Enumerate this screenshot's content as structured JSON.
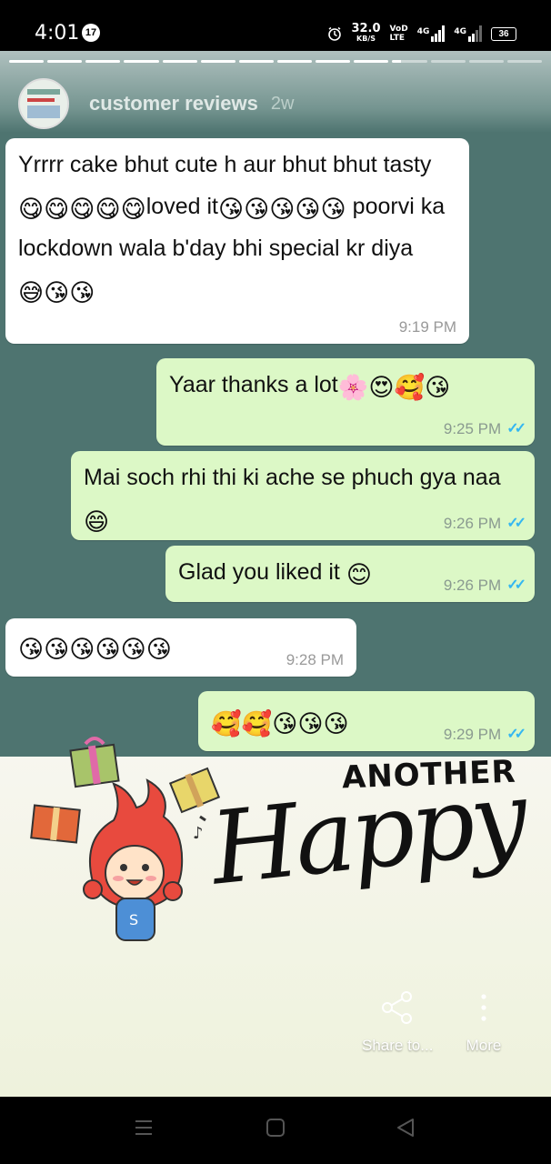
{
  "status_bar": {
    "time": "4:01",
    "notification_count": "17",
    "net_speed_value": "32.0",
    "net_speed_unit": "KB/S",
    "volte_top": "VoD",
    "volte_bottom": "LTE",
    "sim1_label": "4G",
    "sim2_label": "4G",
    "battery": "36"
  },
  "story": {
    "account_name": "customer reviews",
    "posted_ago": "2w",
    "segments_total": 14,
    "segments_done": 10
  },
  "chat": [
    {
      "dir": "in",
      "text": "Yrrrr cake bhut cute h aur bhut bhut tasty ",
      "emoji": "😋😋😋😋😋",
      "text2": "loved it",
      "emoji2": "😘😘😘😘😘",
      "text3": " poorvi ka lockdown wala b'day bhi special kr diya",
      "emoji3": "😅😘😘",
      "time": "9:19 PM"
    },
    {
      "dir": "out",
      "text": "Yaar thanks a lot",
      "emoji": "🌸😍🥰😘",
      "time": "9:25 PM"
    },
    {
      "dir": "out",
      "text": "Mai soch rhi thi ki ache se phuch gya naa",
      "emoji": "😄",
      "time": "9:26 PM"
    },
    {
      "dir": "out",
      "text": "Glad you liked it ",
      "emoji": "😊",
      "time": "9:26 PM"
    },
    {
      "dir": "in",
      "text": "",
      "emoji": "😘😘😘😘😘😘",
      "time": "9:28 PM"
    },
    {
      "dir": "out",
      "text": "",
      "emoji": "🥰🥰😘😘😘",
      "time": "9:29 PM"
    }
  ],
  "sticker": {
    "line1": "ANOTHER",
    "line2": "Happy",
    "mascot_letter": "S"
  },
  "actions": {
    "share_label": "Share to...",
    "more_label": "More"
  },
  "icons": [
    "alarm-icon",
    "share-icon",
    "more-vertical-icon",
    "menu-icon",
    "home-square-icon",
    "back-triangle-icon"
  ]
}
